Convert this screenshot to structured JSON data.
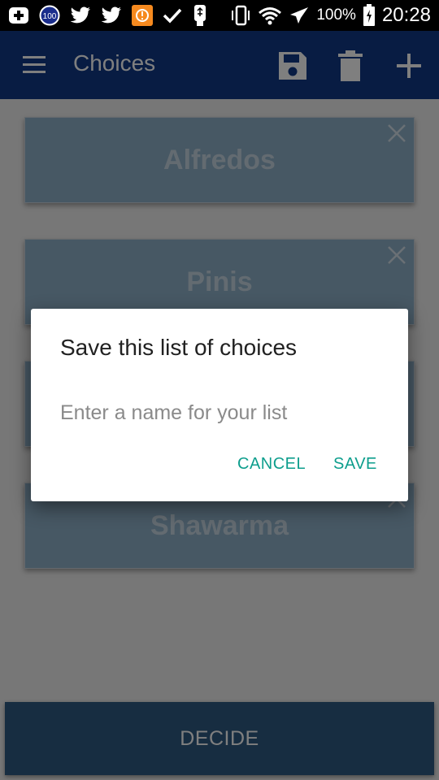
{
  "status_bar": {
    "badge_value": "100",
    "battery_percent": "100%",
    "time": "20:28",
    "icons": [
      "add-box-icon",
      "badge-100-icon",
      "twitter-icon",
      "twitter-icon",
      "orange-app-icon",
      "check-icon",
      "usb-icon",
      "vibrate-icon",
      "wifi-icon",
      "airplane-icon",
      "battery-charging-icon"
    ]
  },
  "app_bar": {
    "title": "Choices",
    "actions": [
      "menu-icon",
      "save-icon",
      "delete-icon",
      "add-icon"
    ]
  },
  "choices": [
    {
      "label": "Alfredos"
    },
    {
      "label": "Pinis"
    },
    {
      "label": ""
    },
    {
      "label": "Shawarma"
    }
  ],
  "decide_label": "DECIDE",
  "dialog": {
    "title": "Save this list of choices",
    "input_placeholder": "Enter a name for your list",
    "input_value": "",
    "cancel_label": "CANCEL",
    "save_label": "SAVE"
  },
  "colors": {
    "app_bar": "#113987",
    "card": "#8fb0c8",
    "decide_button": "#2f5a82",
    "dialog_accent": "#0e9e8d"
  }
}
